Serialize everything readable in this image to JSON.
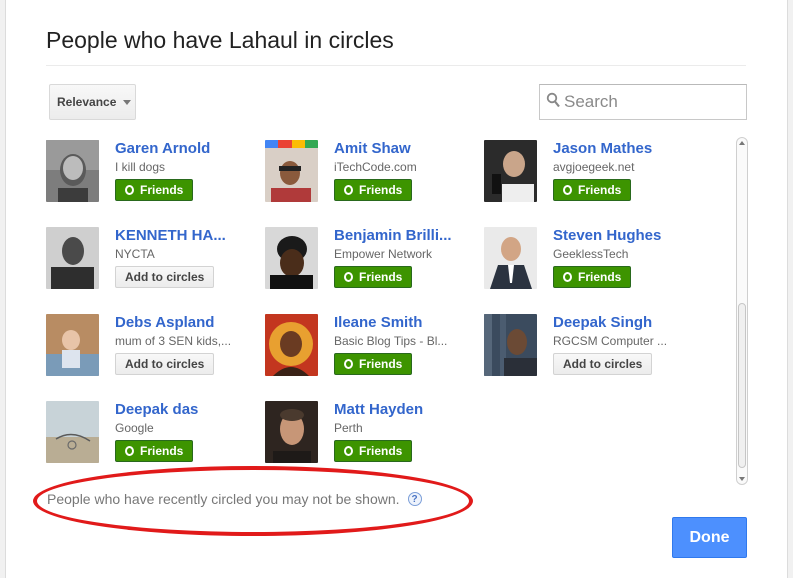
{
  "dialog": {
    "title": "People who have Lahaul in circles"
  },
  "controls": {
    "sort_label": "Relevance",
    "search_placeholder": "Search"
  },
  "people": [
    {
      "name": "Garen Arnold",
      "subtitle": "I kill dogs",
      "action": "Friends",
      "in_circles": true
    },
    {
      "name": "Amit Shaw",
      "subtitle": "iTechCode.com",
      "action": "Friends",
      "in_circles": true
    },
    {
      "name": "Jason Mathes",
      "subtitle": "avgjoegeek.net",
      "action": "Friends",
      "in_circles": true
    },
    {
      "name": "KENNETH HA...",
      "subtitle": "NYCTA",
      "action": "Add to circles",
      "in_circles": false
    },
    {
      "name": "Benjamin Brilli...",
      "subtitle": "Empower Network",
      "action": "Friends",
      "in_circles": true
    },
    {
      "name": "Steven Hughes",
      "subtitle": "GeeklessTech",
      "action": "Friends",
      "in_circles": true
    },
    {
      "name": "Debs Aspland",
      "subtitle": "mum of 3 SEN kids,...",
      "action": "Add to circles",
      "in_circles": false
    },
    {
      "name": "Ileane Smith",
      "subtitle": "Basic Blog Tips - Bl...",
      "action": "Friends",
      "in_circles": true
    },
    {
      "name": "Deepak Singh",
      "subtitle": "RGCSM Computer ...",
      "action": "Add to circles",
      "in_circles": false
    },
    {
      "name": "Deepak das",
      "subtitle": "Google",
      "action": "Friends",
      "in_circles": true
    },
    {
      "name": "Matt Hayden",
      "subtitle": "Perth",
      "action": "Friends",
      "in_circles": true
    }
  ],
  "footer": {
    "note": "People who have recently circled you may not be shown.",
    "help_icon": "?",
    "done_label": "Done"
  },
  "colors": {
    "link": "#3366cc",
    "friends_button": "#3d9400",
    "done_button": "#4d90fe",
    "annotation_ellipse": "#e11a1a"
  }
}
